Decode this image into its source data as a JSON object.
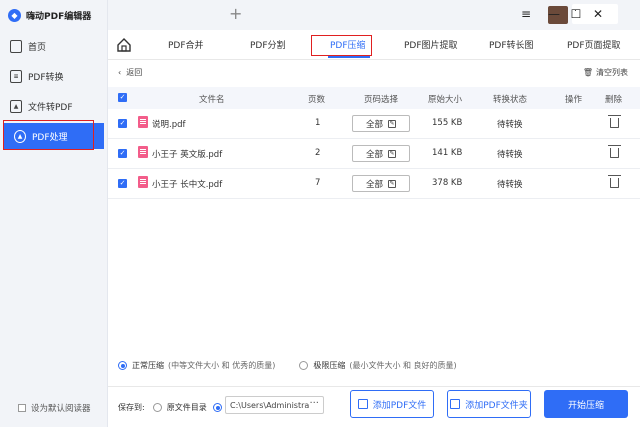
{
  "app": {
    "title": "嗨动PDF编辑器"
  },
  "titlebar": {
    "user_name": "."
  },
  "sidebar": {
    "items": [
      {
        "label": "首页"
      },
      {
        "label": "PDF转换"
      },
      {
        "label": "文件转PDF"
      },
      {
        "label": "PDF处理"
      }
    ],
    "default_reader": "设为默认阅读器"
  },
  "tabs": [
    {
      "label": "PDF合并"
    },
    {
      "label": "PDF分割"
    },
    {
      "label": "PDF压缩"
    },
    {
      "label": "PDF图片提取"
    },
    {
      "label": "PDF转长图"
    },
    {
      "label": "PDF页面提取"
    }
  ],
  "main": {
    "back": "返回",
    "clear_list": "清空列表",
    "columns": [
      "文件名",
      "页数",
      "页码选择",
      "原始大小",
      "转换状态",
      "操作",
      "删除"
    ],
    "rows": [
      {
        "name": "说明.pdf",
        "pages": "1",
        "page_select": "全部",
        "size": "155 KB",
        "status": "待转换"
      },
      {
        "name": "小王子 英文版.pdf",
        "pages": "2",
        "page_select": "全部",
        "size": "141 KB",
        "status": "待转换"
      },
      {
        "name": "小王子 长中文.pdf",
        "pages": "7",
        "page_select": "全部",
        "size": "378 KB",
        "status": "待转换"
      }
    ]
  },
  "compress": {
    "normal_label": "正常压缩",
    "normal_desc": "(中等文件大小 和 优秀的质量)",
    "extreme_label": "极限压缩",
    "extreme_desc": "(最小文件大小 和 良好的质量)"
  },
  "save": {
    "label": "保存到:",
    "original_dir": "原文件目录",
    "path": "C:\\Users\\Administra...",
    "dots": "···"
  },
  "buttons": {
    "add_file": "添加PDF文件",
    "add_folder": "添加PDF文件夹",
    "start": "开始压缩"
  },
  "colors": {
    "accent": "#2f6df6",
    "highlight": "#e02020"
  }
}
